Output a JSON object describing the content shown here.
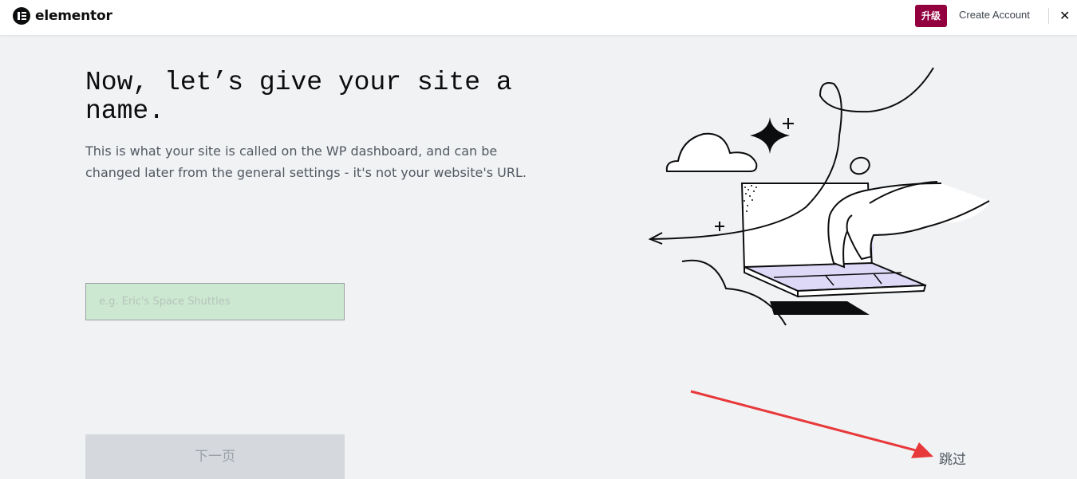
{
  "header": {
    "brand": "elementor",
    "upgrade_label": "升级",
    "create_account_label": "Create Account",
    "close_symbol": "✕"
  },
  "main": {
    "heading": "Now, let’s give your site a name.",
    "description": "This is what your site is called on the WP dashboard, and can be changed later from the general settings - it's not your website's URL.",
    "site_name_input": {
      "value": "",
      "placeholder": "e.g. Eric's Space Shuttles"
    },
    "next_button_label": "下一页",
    "skip_label": "跳过"
  },
  "colors": {
    "upgrade_bg": "#93003f",
    "input_bg": "#cde8d0",
    "background": "#f1f2f4",
    "annotation_arrow": "#e8393a",
    "illustration_accent": "#ddd9f7"
  },
  "icons": {
    "logo": "elementor-logo-icon",
    "close": "close-icon",
    "annotation": "red-arrow-icon"
  }
}
